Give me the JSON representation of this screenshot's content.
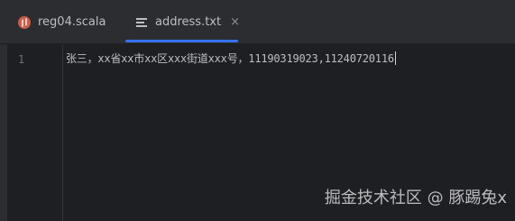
{
  "tabs": [
    {
      "label": "reg04.scala",
      "icon": "scala-file-icon",
      "active": false
    },
    {
      "label": "address.txt",
      "icon": "text-file-icon",
      "active": true,
      "close": "×"
    }
  ],
  "editor": {
    "line_number": "1",
    "line_text": "张三，xx省xx市xx区xxx街道xxx号，11190319023,11240720116"
  },
  "watermark": "掘金技术社区 @ 豚踢兔x",
  "colors": {
    "background": "#1e1f22",
    "tabbar": "#2b2d30",
    "active_tab_underline": "#3574f0",
    "text": "#bcbec4",
    "line_number": "#6f737a",
    "scala_icon": "#c95e4a"
  }
}
